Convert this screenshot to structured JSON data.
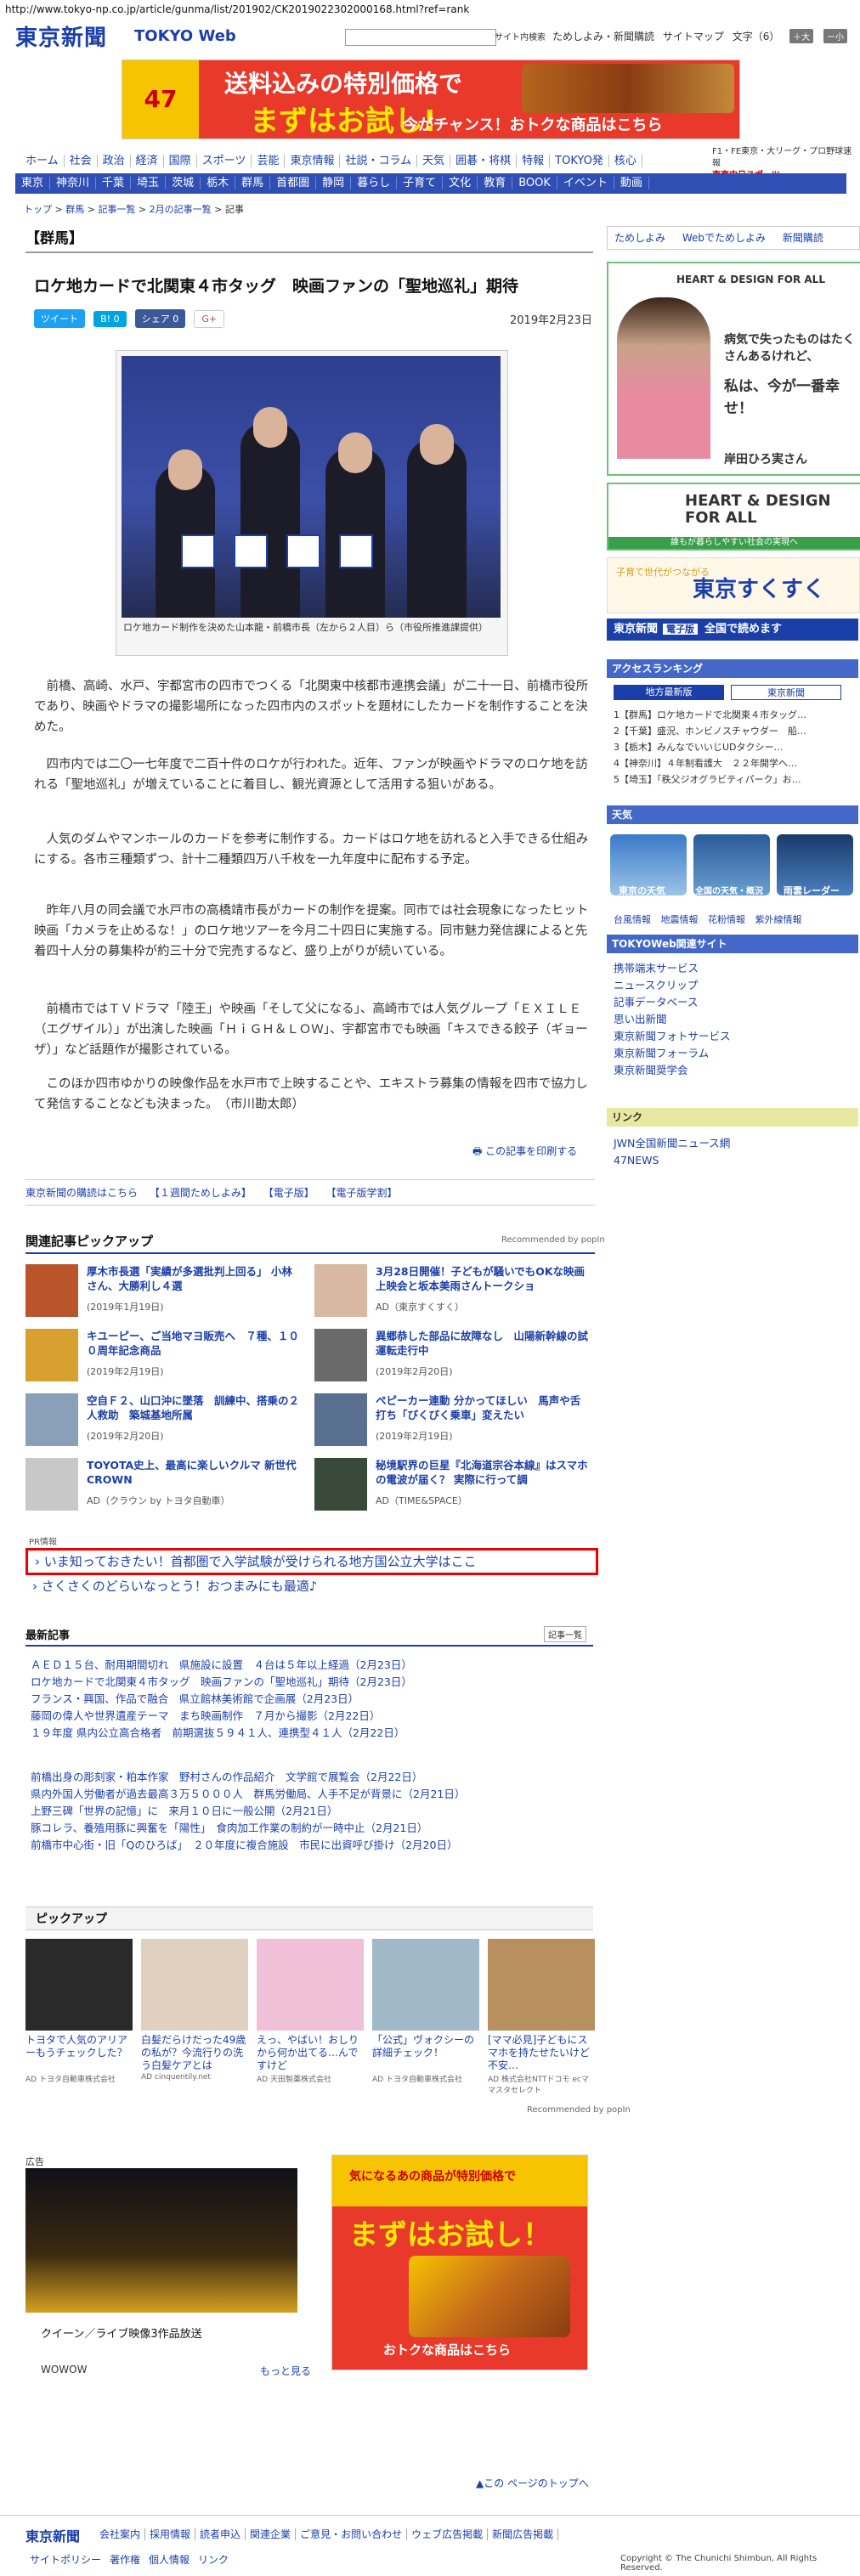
{
  "url": "http://www.tokyo-np.co.jp/article/gunma/list/201902/CK2019022302000168.html?ref=rank",
  "header": {
    "logo": "東京新聞",
    "logo_web": "TOKYO Web",
    "search_button": "サイト内検索",
    "links": [
      "ためしよみ・新聞購読",
      "サイトマップ",
      "文字（6）"
    ],
    "font_plus": "＋大",
    "font_minus": "ー小"
  },
  "top_ad": {
    "badge": "47",
    "line1": "送料込みの特別価格で",
    "line2": "まずはお試し!",
    "line3": "今がチャンス！おトクな商品はこちら"
  },
  "nav_primary": [
    "ホーム",
    "社会",
    "政治",
    "経済",
    "国際",
    "スポーツ",
    "芸能",
    "東京情報",
    "社説・コラム",
    "天気",
    "囲碁・将棋",
    "特報",
    "TOKYO発",
    "核心"
  ],
  "nav_right": [
    "F1・FE東京・大リーグ・プロ野球速報",
    "東京中日スポーツ"
  ],
  "nav_secondary": [
    "東京",
    "神奈川",
    "千葉",
    "埼玉",
    "茨城",
    "栃木",
    "群馬",
    "首都圏",
    "静岡",
    "暮らし",
    "子育て",
    "文化",
    "教育",
    "BOOK",
    "イベント",
    "動画"
  ],
  "breadcrumb": [
    "トップ",
    "群馬",
    "記事一覧",
    "2月の記事一覧",
    "記事"
  ],
  "section": "【群馬】",
  "article": {
    "headline": "ロケ地カードで北関東４市タッグ　映画ファンの「聖地巡礼」期待",
    "share": [
      "ツイート",
      "B! 0",
      "シェア 0",
      "G+"
    ],
    "date": "2019年2月23日",
    "photo_caption": "ロケ地カード制作を決めた山本龍・前橋市長（左から２人目）ら（市役所推進課提供）",
    "paragraphs": [
      "前橋、高崎、水戸、宇都宮市の四市でつくる「北関東中核都市連携会議」が二十一日、前橋市役所であり、映画やドラマの撮影場所になった四市内のスポットを題材にしたカードを制作することを決めた。",
      "四市内では二〇一七年度で二百十件のロケが行われた。近年、ファンが映画やドラマのロケ地を訪れる「聖地巡礼」が増えていることに着目し、観光資源として活用する狙いがある。",
      "人気のダムやマンホールのカードを参考に制作する。カードはロケ地を訪れると入手できる仕組みにする。各市三種類ずつ、計十二種類四万八千枚を一九年度中に配布する予定。",
      "昨年八月の同会議で水戸市の高橋靖市長がカードの制作を提案。同市では社会現象になったヒット映画「カメラを止めるな！」のロケ地ツアーを今月二十四日に実施する。同市魅力発信課によると先着四十人分の募集枠が約三十分で完売するなど、盛り上がりが続いている。",
      "前橋市ではＴＶドラマ「陸王」や映画「そして父になる」、高崎市では人気グループ「ＥＸＩＬＥ（エグザイル）」が出演した映画「ＨｉＧＨ＆ＬＯＷ」、宇都宮市でも映画「キスできる餃子（ギョーザ）」など話題作が撮影されている。",
      "このほか四市ゆかりの映像作品を水戸市で上映することや、エキストラ募集の情報を四市で協力して発信することなども決まった。　（市川勘太郎）"
    ],
    "print_link": "この記事を印刷する"
  },
  "subscribe_links": [
    "東京新聞の購読はこちら",
    "【１週間ためしよみ】",
    "【電子版】",
    "【電子版学割】"
  ],
  "related": {
    "title": "関連記事ピックアップ",
    "by": "Recommended by popIn",
    "items": [
      {
        "title": "厚木市長選「実績が多選批判上回る」 小林さん、大勝利し４選",
        "sub": "(2019年1月19日)",
        "color": "#b8552a"
      },
      {
        "title": "3月28日開催！子どもが騒いでもOKな映画上映会と坂本美雨さんトークショ",
        "sub": "AD（東京すくすく）",
        "color": "#d8b8a0"
      },
      {
        "title": "キユーピー、ご当地マヨ販売へ　７種、１００周年記念商品",
        "sub": "(2019年2月19日)",
        "color": "#d8a030"
      },
      {
        "title": "異郷恭した部品に故障なし　山陽新幹線の試運転走行中",
        "sub": "(2019年2月20日)",
        "color": "#6a6a6a"
      },
      {
        "title": "空自Ｆ２、山口沖に墜落　訓練中、搭乗の２人救助　築城基地所属",
        "sub": "(2019年2月20日)",
        "color": "#8aa0b8"
      },
      {
        "title": "ペピーカー連動 分かってほしい　馬声や舌打ち「びくびく乗車」変えたい",
        "sub": "(2019年2月19日)",
        "color": "#5a7090"
      },
      {
        "title": "TOYOTA史上、最高に楽しいクルマ 新世代CROWN",
        "sub": "AD（クラウン by トヨタ自動車）",
        "color": "#c8c8c8"
      },
      {
        "title": "秘境駅界の巨星『北海道宗谷本線』はスマホの電波が届く？ 実際に行って調",
        "sub": "AD（TIME&SPACE）",
        "color": "#3a4a3a"
      }
    ]
  },
  "pr": {
    "label": "PR情報",
    "items": [
      "いま知っておきたい！首都圏で入学試験が受けられる地方国公立大学はここ",
      "さくさくのどらいなっとう！おつまみにも最適♪"
    ]
  },
  "latest": {
    "title": "最新記事",
    "more": "記事一覧",
    "group1": [
      "ＡＥＤ１５台、耐用期間切れ　県施設に設置　４台は５年以上経過（2月23日）",
      "ロケ地カードで北関東４市タッグ　映画ファンの「聖地巡礼」期待（2月23日）",
      "フランス・興国、作品で融合　県立館林美術館で企画展（2月23日）",
      "藤岡の偉人や世界遺産テーマ　まち映画制作　７月から撮影（2月22日）",
      "１９年度 県内公立高合格者　前期選抜５９４１人、連携型４１人（2月22日）"
    ],
    "group2": [
      "前橋出身の彫刻家・粕本作家　野村さんの作品紹介　文学館で展覧会（2月22日）",
      "県内外国人労働者が過去最高３万５０００人　群馬労働局、人手不足が背景に（2月21日）",
      "上野三碑「世界の記憶」に　来月１０日に一般公開（2月21日）",
      "豚コレラ、養殖用豚に興奮を「陽性」　食肉加工作業の制約が一時中止（2月21日）",
      "前橋市中心街・旧「Qのひろば」　２０年度に複合施設　市民に出資呼び掛け（2月20日）"
    ]
  },
  "pickup": {
    "title": "ピックアップ",
    "items": [
      {
        "title": "トヨタで人気のアリアーもうチェックした？",
        "src": "AD トヨタ自動車株式会社",
        "color": "#2a2a2a"
      },
      {
        "title": "白髪だらけだった49歳の私が？今流行りの洗う白髪ケアとは",
        "src": "AD cinquentily.net",
        "color": "#e0d0c0"
      },
      {
        "title": "えっ、やばい！おしりから何か出てる…んですけど",
        "src": "AD 天田製薬株式会社",
        "color": "#f0c0d8"
      },
      {
        "title": "「公式」ヴォクシーの詳細チェック！",
        "src": "AD トヨタ自動車株式会社",
        "color": "#a0b8c8"
      },
      {
        "title": "[ママ必見]子どもにスマホを持たせたいけど不安…",
        "src": "AD 株式会社NTTドコモ ecママスタセレクト",
        "color": "#b89060"
      }
    ],
    "by": "Recommended by popIn"
  },
  "bottom_ads": {
    "label": "広告",
    "left_title": "クイーン／ライブ映像3作品放送",
    "left_brand": "WOWOW",
    "left_more": "もっと見る",
    "right_small": "気になるあの商品が特別価格で",
    "right_big": "まずはお試し！",
    "right_sub": "おトクな商品はこちら"
  },
  "page_top": "この ページのトップへ",
  "footer": {
    "logo": "東京新聞",
    "links": [
      "会社案内",
      "採用情報",
      "読者申込",
      "関連企業",
      "ご意見・お問い合わせ",
      "ウェブ広告掲載",
      "新聞広告掲載"
    ],
    "links2": [
      "サイトポリシー",
      "著作権",
      "個人情報",
      "リンク"
    ],
    "copyright": "Copyright © The Chunichi Shimbun, All Rights Reserved."
  },
  "sidebar": {
    "top_links": [
      "ためしよみ",
      "Webでためしよみ",
      "新聞購読"
    ],
    "heart": {
      "brand": "HEART & DESIGN FOR ALL",
      "text": [
        "病気で失ったものはたくさんあるけれど、",
        "私は、今が一番幸せ！"
      ],
      "name": "岸田ひろ実さん"
    },
    "heart2": {
      "text": "HEART & DESIGN FOR ALL",
      "bar": "誰もが暮らしやすい社会の実現へ"
    },
    "suku": {
      "small": "子育て世代がつながる",
      "big": "東京すくすく"
    },
    "denshi": {
      "logo": "東京新聞",
      "badge": "電子版",
      "text": "全国で読めます"
    },
    "ranking": {
      "title": "アクセスランキング",
      "tab1": "地方最新版",
      "tab2": "東京新聞",
      "items": [
        "1【群馬】ロケ地カードで北関東４市タッグ…",
        "2【千葉】盛況、ホンビノスチャウダー　船…",
        "3【栃木】みんなでいいじUDタクシー…",
        "4【神奈川】４年制看護大　２２年開学へ…",
        "5【埼玉】「秩父ジオグラビティパーク」お…"
      ]
    },
    "weather": {
      "title": "天気",
      "tiles": [
        "東京の天気",
        "全国の天気・概況",
        "雨雲レーダー"
      ],
      "links": [
        "台風情報",
        "地震情報",
        "花粉情報",
        "紫外線情報"
      ]
    },
    "services": {
      "title": "TOKYOWeb関連サイト",
      "items": [
        "携帯端末サービス",
        "ニュースクリップ",
        "記事データベース",
        "思い出新聞",
        "東京新聞フォトサービス",
        "東京新聞フォーラム",
        "東京新聞奨学会"
      ]
    },
    "links": {
      "title": "リンク",
      "items": [
        "JWN全国新聞ニュース網",
        "47NEWS"
      ]
    }
  }
}
